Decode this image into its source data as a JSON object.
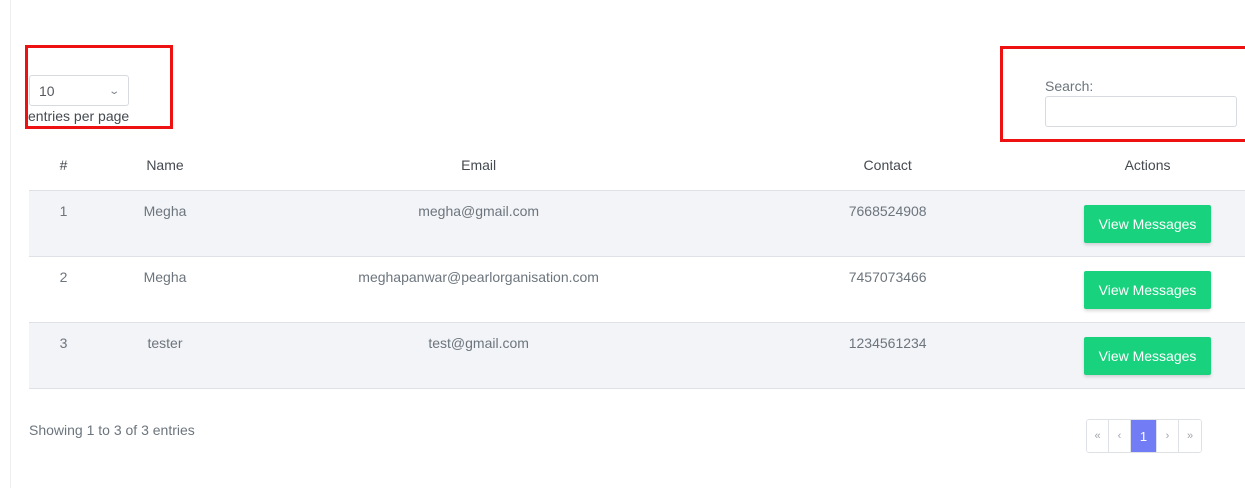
{
  "length_menu": {
    "selected": "10",
    "label": "entries per page"
  },
  "search": {
    "label": "Search:",
    "value": "",
    "placeholder": ""
  },
  "table": {
    "columns": [
      "#",
      "Name",
      "Email",
      "Contact",
      "Actions"
    ],
    "rows": [
      {
        "num": "1",
        "name": "Megha",
        "email": "megha@gmail.com",
        "contact": "7668524908",
        "action": "View Messages"
      },
      {
        "num": "2",
        "name": "Megha",
        "email": "meghapanwar@pearlorganisation.com",
        "contact": "7457073466",
        "action": "View Messages"
      },
      {
        "num": "3",
        "name": "tester",
        "email": "test@gmail.com",
        "contact": "1234561234",
        "action": "View Messages"
      }
    ]
  },
  "info": "Showing 1 to 3 of 3 entries",
  "pagination": {
    "first": "«",
    "prev": "‹",
    "current": "1",
    "next": "›",
    "last": "»"
  },
  "colors": {
    "accent_green": "#19d27e",
    "active_page": "#727cf5",
    "highlight_red": "#ee1111"
  }
}
